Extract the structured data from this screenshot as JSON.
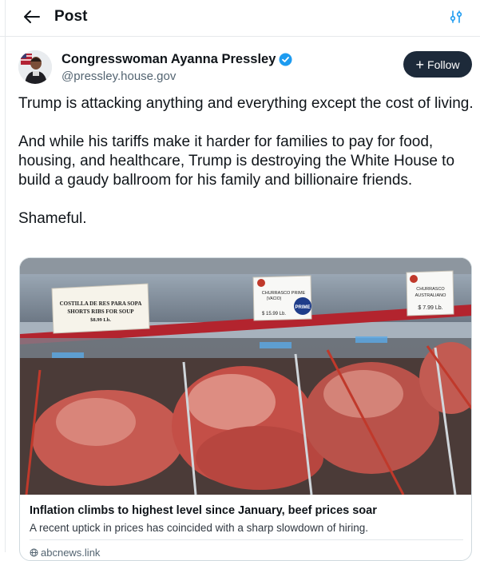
{
  "header": {
    "title": "Post",
    "back_icon": "arrow-left-icon",
    "settings_icon": "sliders-icon"
  },
  "post": {
    "author_name": "Congresswoman Ayanna Pressley",
    "handle": "@pressley.house.gov",
    "verified_icon": "verified-badge-icon",
    "follow_label": "Follow",
    "paragraphs": [
      "Trump is attacking anything and everything except the cost of living.",
      "And while his tariffs make it harder for families to pay for food, housing, and healthcare, Trump is destroying the White House to build a gaudy ballroom for his family and billionaire friends.",
      "Shameful."
    ]
  },
  "link_card": {
    "image_signs": [
      {
        "lines": [
          "COSTILLA DE RES PARA SOPA",
          "SHORTS RIBS FOR SOUP",
          "$8.99 Lb."
        ]
      },
      {
        "lines": [
          "CHURRASCO PRIME",
          "(VACIO)",
          "$ 15.99 Lb."
        ],
        "badge": "PRIME"
      },
      {
        "lines": [
          "CHURRASCO",
          "AUSTRALIANO",
          "$ 7.99 Lb."
        ]
      }
    ],
    "title": "Inflation climbs to highest level since January, beef prices soar",
    "description": "A recent uptick in prices has coincided with a sharp slowdown of hiring.",
    "domain": "abcnews.link"
  },
  "colors": {
    "accent": "#1d9bf0",
    "follow_bg": "#1d2a3a",
    "meat_red": "#c0504a",
    "rail_red": "#b3242e"
  }
}
